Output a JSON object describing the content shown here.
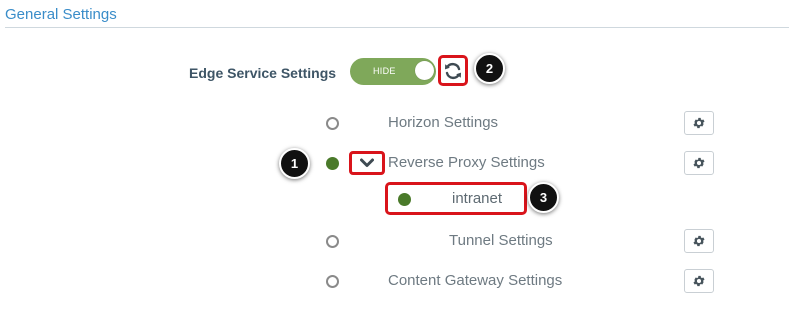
{
  "header": {
    "title": "General Settings"
  },
  "edge": {
    "label": "Edge Service Settings",
    "toggle_label": "HIDE"
  },
  "rows": [
    {
      "label": "Horizon Settings",
      "enabled": false
    },
    {
      "label": "Reverse Proxy Settings",
      "enabled": true,
      "expanded": true
    },
    {
      "label": "intranet",
      "enabled": true
    },
    {
      "label": "Tunnel Settings",
      "enabled": false
    },
    {
      "label": "Content Gateway Settings",
      "enabled": false
    }
  ],
  "callouts": [
    "1",
    "2",
    "3"
  ],
  "colors": {
    "accent": "#3a8dc9",
    "toggle": "#7fa85a",
    "enabled_dot": "#4a7a2a",
    "highlight": "#d9141b"
  },
  "icons": {
    "refresh": "refresh-icon",
    "gear": "gear-icon",
    "expand": "chevron-down-icon"
  }
}
